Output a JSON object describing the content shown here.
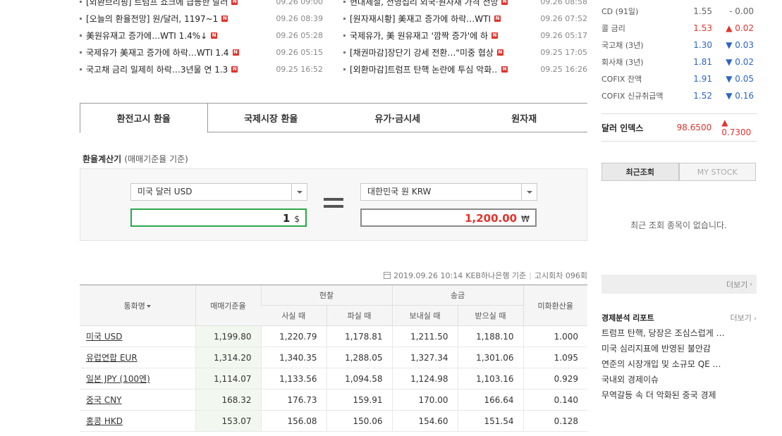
{
  "news": {
    "left": [
      {
        "title": "[외환브리핑] 트럼프 쇼크에 급등한 달러",
        "time": "09.26 09:00"
      },
      {
        "title": "[오늘의 환율전망] 원/달러, 1197~1",
        "time": "09.26 08:39"
      },
      {
        "title": "美원유재고 증가에…WTI 1.4%↓",
        "time": "09.26 05:28"
      },
      {
        "title": "국제유가 美재고 증가에 하락…WTI 1.4",
        "time": "09.26 05:15"
      },
      {
        "title": "국고채 금리 일제히 하락…3년물 연 1.3",
        "time": "09.25 16:52"
      }
    ],
    "right": [
      {
        "title": "현대제철, 전영섭리 외국·원자재 가격 전망",
        "time": "09.26 08:58"
      },
      {
        "title": "[원자재시황] 美재고 증가에 하락…WTI",
        "time": "09.26 07:52"
      },
      {
        "title": "국제유가, 美 원유재고 '깜짝 증가'에 하",
        "time": "09.26 05:17"
      },
      {
        "title": "[채권마감]장단기 강세 전환…\"미중 협상",
        "time": "09.25 17:05"
      },
      {
        "title": "[외환마감]트럼프 탄핵 논란에 투심 악화…",
        "time": "09.25 16:26"
      }
    ],
    "badge": "N"
  },
  "tabs": [
    {
      "label": "환전고시 환율",
      "active": true
    },
    {
      "label": "국제시장 환율",
      "active": false
    },
    {
      "label": "유가·금시세",
      "active": false
    },
    {
      "label": "원자재",
      "active": false
    }
  ],
  "calculator": {
    "title": "환율계산기",
    "subtitle": "(매매기준율 기준)",
    "from_currency": "미국 달러 USD",
    "from_amount": "1",
    "from_unit": "$",
    "to_currency": "대한민국 원 KRW",
    "to_amount": "1,200.00",
    "to_unit": "₩"
  },
  "table_meta": {
    "date": "2019.09.26 10:14",
    "source": "KEB하나은행 기준",
    "notice": "고시회차 096회"
  },
  "rate_table": {
    "headers": {
      "currency": "통화명",
      "standard": "매매기준율",
      "cash": "현찰",
      "cash_buy": "사실 때",
      "cash_sell": "파실 때",
      "wire": "송금",
      "wire_send": "보내실 때",
      "wire_receive": "받으실 때",
      "usd_ratio": "미화환산율"
    },
    "rows": [
      {
        "currency": "미국 USD",
        "standard": "1,199.80",
        "cash_buy": "1,220.79",
        "cash_sell": "1,178.81",
        "wire_send": "1,211.50",
        "wire_receive": "1,188.10",
        "usd_ratio": "1.000"
      },
      {
        "currency": "유럽연합 EUR",
        "standard": "1,314.20",
        "cash_buy": "1,340.35",
        "cash_sell": "1,288.05",
        "wire_send": "1,327.34",
        "wire_receive": "1,301.06",
        "usd_ratio": "1.095"
      },
      {
        "currency": "일본 JPY (100엔)",
        "standard": "1,114.07",
        "cash_buy": "1,133.56",
        "cash_sell": "1,094.58",
        "wire_send": "1,124.98",
        "wire_receive": "1,103.16",
        "usd_ratio": "0.929"
      },
      {
        "currency": "중국 CNY",
        "standard": "168.32",
        "cash_buy": "176.73",
        "cash_sell": "159.91",
        "wire_send": "170.00",
        "wire_receive": "166.64",
        "usd_ratio": "0.140"
      },
      {
        "currency": "홍콩 HKD",
        "standard": "153.07",
        "cash_buy": "156.08",
        "cash_sell": "150.06",
        "wire_send": "154.60",
        "wire_receive": "151.54",
        "usd_ratio": "0.128"
      }
    ]
  },
  "market": {
    "rows": [
      {
        "name": "CD (91일)",
        "value": "1.55",
        "dir": "flat",
        "arrow": "-",
        "change": "0.00"
      },
      {
        "name": "콜 금리",
        "value": "1.53",
        "dir": "up",
        "arrow": "▲",
        "change": "0.02"
      },
      {
        "name": "국고채 (3년)",
        "value": "1.30",
        "dir": "down",
        "arrow": "▼",
        "change": "0.03"
      },
      {
        "name": "회사채 (3년)",
        "value": "1.81",
        "dir": "down",
        "arrow": "▼",
        "change": "0.02"
      },
      {
        "name": "COFIX 잔액",
        "value": "1.91",
        "dir": "down",
        "arrow": "▼",
        "change": "0.05"
      },
      {
        "name": "COFIX 신규취급액",
        "value": "1.52",
        "dir": "down",
        "arrow": "▼",
        "change": "0.16"
      }
    ],
    "dollar_index": {
      "name": "달러 인덱스",
      "value": "98.6500",
      "change": "▲ 0.7300"
    }
  },
  "recent": {
    "tab_recent": "최근조회",
    "tab_my": "MY STOCK",
    "empty": "최근 조회 종목이 없습니다.",
    "more": "더보기"
  },
  "reports": {
    "title": "경제분석 리포트",
    "more": "더보기",
    "items": [
      "트럼프 탄핵, 당장은 조심스럽게 …",
      "미국 심리지표에 반영된 불안감",
      "연준의 시장개입 및 소규모 QE …",
      "국내외 경제이슈",
      "무역갈등 속 더 악화된 중국 경제"
    ]
  },
  "colors": {
    "up": "#e4322b",
    "down": "#2e63c9",
    "accent_green": "#2da84a"
  }
}
